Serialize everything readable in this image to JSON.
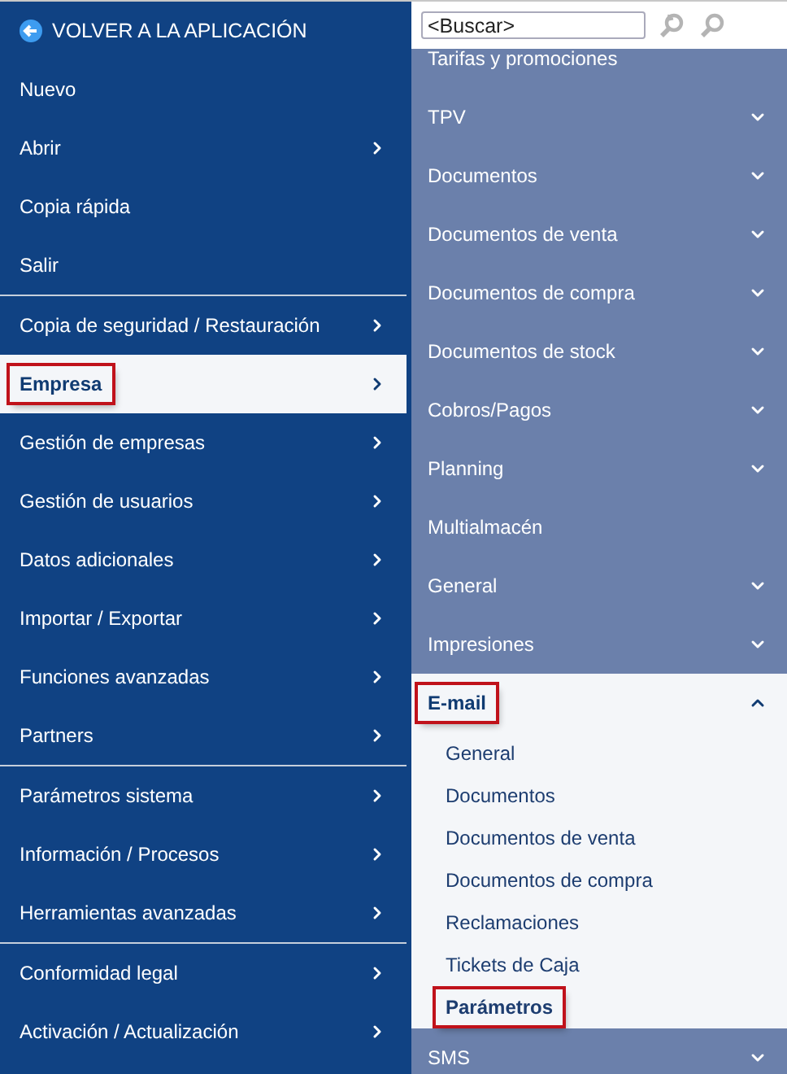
{
  "back_button": {
    "label": "VOLVER A LA APLICACIÓN"
  },
  "main_menu": [
    {
      "label": "Nuevo",
      "has_submenu": false,
      "selected": false,
      "highlighted": false,
      "divider_before": false
    },
    {
      "label": "Abrir",
      "has_submenu": true,
      "selected": false,
      "highlighted": false,
      "divider_before": false
    },
    {
      "label": "Copia rápida",
      "has_submenu": false,
      "selected": false,
      "highlighted": false,
      "divider_before": false
    },
    {
      "label": "Salir",
      "has_submenu": false,
      "selected": false,
      "highlighted": false,
      "divider_before": false
    },
    {
      "label": "Copia de seguridad / Restauración",
      "has_submenu": true,
      "selected": false,
      "highlighted": false,
      "divider_before": true
    },
    {
      "label": "Empresa",
      "has_submenu": true,
      "selected": true,
      "highlighted": true,
      "divider_before": false
    },
    {
      "label": "Gestión de empresas",
      "has_submenu": true,
      "selected": false,
      "highlighted": false,
      "divider_before": false
    },
    {
      "label": "Gestión de usuarios",
      "has_submenu": true,
      "selected": false,
      "highlighted": false,
      "divider_before": false
    },
    {
      "label": "Datos adicionales",
      "has_submenu": true,
      "selected": false,
      "highlighted": false,
      "divider_before": false
    },
    {
      "label": "Importar / Exportar",
      "has_submenu": true,
      "selected": false,
      "highlighted": false,
      "divider_before": false
    },
    {
      "label": "Funciones avanzadas",
      "has_submenu": true,
      "selected": false,
      "highlighted": false,
      "divider_before": false
    },
    {
      "label": "Partners",
      "has_submenu": true,
      "selected": false,
      "highlighted": false,
      "divider_before": false
    },
    {
      "label": "Parámetros sistema",
      "has_submenu": true,
      "selected": false,
      "highlighted": false,
      "divider_before": true
    },
    {
      "label": "Información / Procesos",
      "has_submenu": true,
      "selected": false,
      "highlighted": false,
      "divider_before": false
    },
    {
      "label": "Herramientas avanzadas",
      "has_submenu": true,
      "selected": false,
      "highlighted": false,
      "divider_before": false
    },
    {
      "label": "Conformidad legal",
      "has_submenu": true,
      "selected": false,
      "highlighted": false,
      "divider_before": true
    },
    {
      "label": "Activación / Actualización",
      "has_submenu": true,
      "selected": false,
      "highlighted": false,
      "divider_before": false
    }
  ],
  "search": {
    "placeholder": "<Buscar>"
  },
  "submenu": [
    {
      "label": "Tarifas y promociones",
      "expandable": false,
      "expanded": false,
      "highlighted": false
    },
    {
      "label": "TPV",
      "expandable": true,
      "expanded": false,
      "highlighted": false
    },
    {
      "label": "Documentos",
      "expandable": true,
      "expanded": false,
      "highlighted": false
    },
    {
      "label": "Documentos de venta",
      "expandable": true,
      "expanded": false,
      "highlighted": false
    },
    {
      "label": "Documentos de compra",
      "expandable": true,
      "expanded": false,
      "highlighted": false
    },
    {
      "label": "Documentos de stock",
      "expandable": true,
      "expanded": false,
      "highlighted": false
    },
    {
      "label": "Cobros/Pagos",
      "expandable": true,
      "expanded": false,
      "highlighted": false
    },
    {
      "label": "Planning",
      "expandable": true,
      "expanded": false,
      "highlighted": false
    },
    {
      "label": "Multialmacén",
      "expandable": false,
      "expanded": false,
      "highlighted": false
    },
    {
      "label": "General",
      "expandable": true,
      "expanded": false,
      "highlighted": false
    },
    {
      "label": "Impresiones",
      "expandable": true,
      "expanded": false,
      "highlighted": false
    },
    {
      "label": "E-mail",
      "expandable": true,
      "expanded": true,
      "highlighted": true,
      "children": [
        {
          "label": "General",
          "selected": false,
          "highlighted": false
        },
        {
          "label": "Documentos",
          "selected": false,
          "highlighted": false
        },
        {
          "label": "Documentos de venta",
          "selected": false,
          "highlighted": false
        },
        {
          "label": "Documentos de compra",
          "selected": false,
          "highlighted": false
        },
        {
          "label": "Reclamaciones",
          "selected": false,
          "highlighted": false
        },
        {
          "label": "Tickets de Caja",
          "selected": false,
          "highlighted": false
        },
        {
          "label": "Parámetros",
          "selected": true,
          "highlighted": true
        }
      ]
    },
    {
      "label": "SMS",
      "expandable": true,
      "expanded": false,
      "highlighted": false
    }
  ]
}
